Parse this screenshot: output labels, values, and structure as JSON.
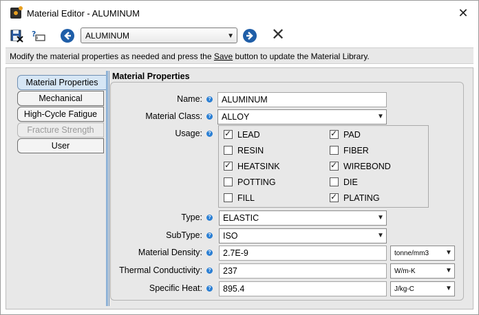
{
  "window": {
    "title": "Material Editor - ALUMINUM"
  },
  "toolbar": {
    "material_selected": "ALUMINUM",
    "icons": [
      "save-icon",
      "rename-icon",
      "back-arrow-icon",
      "forward-arrow-icon",
      "close-x-icon"
    ]
  },
  "instruction": {
    "before": "Modify the material properties as needed and press the ",
    "link": "Save",
    "after": " button to update the Material Library."
  },
  "tabs": [
    {
      "label": "Material Properties",
      "state": "active"
    },
    {
      "label": "Mechanical",
      "state": "normal"
    },
    {
      "label": "High-Cycle Fatigue",
      "state": "normal"
    },
    {
      "label": "Fracture Strength",
      "state": "disabled"
    },
    {
      "label": "User",
      "state": "normal"
    }
  ],
  "panel": {
    "title": "Material Properties",
    "name_label": "Name:",
    "name_value": "ALUMINUM",
    "class_label": "Material Class:",
    "class_value": "ALLOY",
    "usage_label": "Usage:",
    "usage": [
      {
        "label": "LEAD",
        "checked": true
      },
      {
        "label": "PAD",
        "checked": true
      },
      {
        "label": "RESIN",
        "checked": false
      },
      {
        "label": "FIBER",
        "checked": false
      },
      {
        "label": "HEATSINK",
        "checked": true
      },
      {
        "label": "WIREBOND",
        "checked": true
      },
      {
        "label": "POTTING",
        "checked": false
      },
      {
        "label": "DIE",
        "checked": false
      },
      {
        "label": "FILL",
        "checked": false
      },
      {
        "label": "PLATING",
        "checked": true
      }
    ],
    "type_label": "Type:",
    "type_value": "ELASTIC",
    "subtype_label": "SubType:",
    "subtype_value": "ISO",
    "density_label": "Material Density:",
    "density_value": "2.7E-9",
    "density_unit": "tonne/mm3",
    "conductivity_label": "Thermal Conductivity:",
    "conductivity_value": "237",
    "conductivity_unit": "W/m-K",
    "heat_label": "Specific Heat:",
    "heat_value": "895.4",
    "heat_unit": "J/kg-C"
  },
  "colors": {
    "accent": "#1f5ea8",
    "help": "#2a7fd4",
    "tab_active": "#d6e6f5"
  }
}
